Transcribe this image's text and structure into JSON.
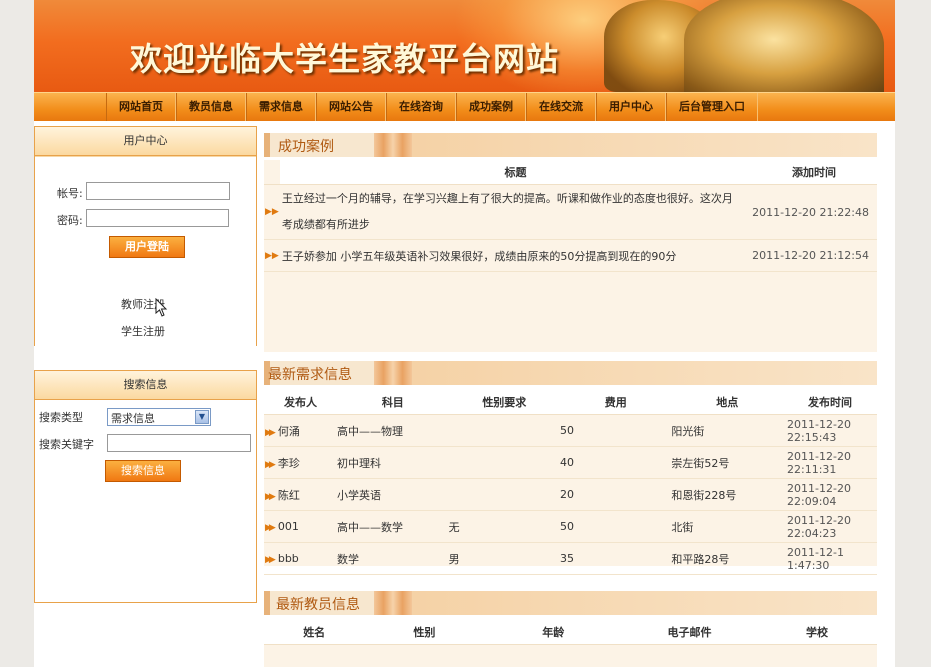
{
  "site": {
    "title": "欢迎光临大学生家教平台网站"
  },
  "nav": [
    {
      "label": "网站首页"
    },
    {
      "label": "教员信息"
    },
    {
      "label": "需求信息"
    },
    {
      "label": "网站公告"
    },
    {
      "label": "在线咨询"
    },
    {
      "label": "成功案例"
    },
    {
      "label": "在线交流"
    },
    {
      "label": "用户中心"
    },
    {
      "label": "后台管理入口"
    }
  ],
  "user_center": {
    "title": "用户中心",
    "account_label": "帐号:",
    "password_label": "密码:",
    "account_value": "",
    "password_value": "",
    "login_button": "用户登陆",
    "teacher_register": "教师注册",
    "student_register": "学生注册"
  },
  "search": {
    "title": "搜索信息",
    "type_label": "搜索类型",
    "type_selected": "需求信息",
    "keyword_label": "搜索关键字",
    "keyword_value": "",
    "button": "搜索信息"
  },
  "success_cases": {
    "title": "成功案例",
    "headers": [
      "标题",
      "添加时间"
    ],
    "rows": [
      {
        "title_line1": "王立经过一个月的辅导，在学习兴趣上有了很大的提高。听课和做作业的态度也很好。这次月",
        "title_line2": "考成绩都有所进步",
        "time": "2011-12-20 21:22:48"
      },
      {
        "title_line1": "王子娇参加 小学五年级英语补习效果很好，成绩由原来的50分提高到现在的90分",
        "title_line2": "",
        "time": "2011-12-20 21:12:54"
      }
    ]
  },
  "latest_demands": {
    "title": "最新需求信息",
    "headers": [
      "发布人",
      "科目",
      "性别要求",
      "费用",
      "地点",
      "发布时间"
    ],
    "rows": [
      {
        "publisher": "何涌",
        "subject": "高中——物理",
        "gender": "",
        "fee": "50",
        "location": "阳光街",
        "time": "2011-12-20 22:15:43"
      },
      {
        "publisher": "李珍",
        "subject": "初中理科",
        "gender": "",
        "fee": "40",
        "location": "崇左街52号",
        "time": "2011-12-20 22:11:31"
      },
      {
        "publisher": "陈红",
        "subject": "小学英语",
        "gender": "",
        "fee": "20",
        "location": "和恩街228号",
        "time": "2011-12-20 22:09:04"
      },
      {
        "publisher": "001",
        "subject": "高中——数学",
        "gender": "无",
        "fee": "50",
        "location": "北街",
        "time": "2011-12-20 22:04:23"
      },
      {
        "publisher": "bbb",
        "subject": "数学",
        "gender": "男",
        "fee": "35",
        "location": "和平路28号",
        "time": "2011-12-1 1:47:30"
      }
    ]
  },
  "latest_teachers": {
    "title": "最新教员信息",
    "headers": [
      "姓名",
      "性别",
      "年龄",
      "电子邮件",
      "学校"
    ]
  },
  "colors": {
    "accent": "#f28d1a",
    "section_title": "#b05a12",
    "banner": "#f26d1f"
  }
}
